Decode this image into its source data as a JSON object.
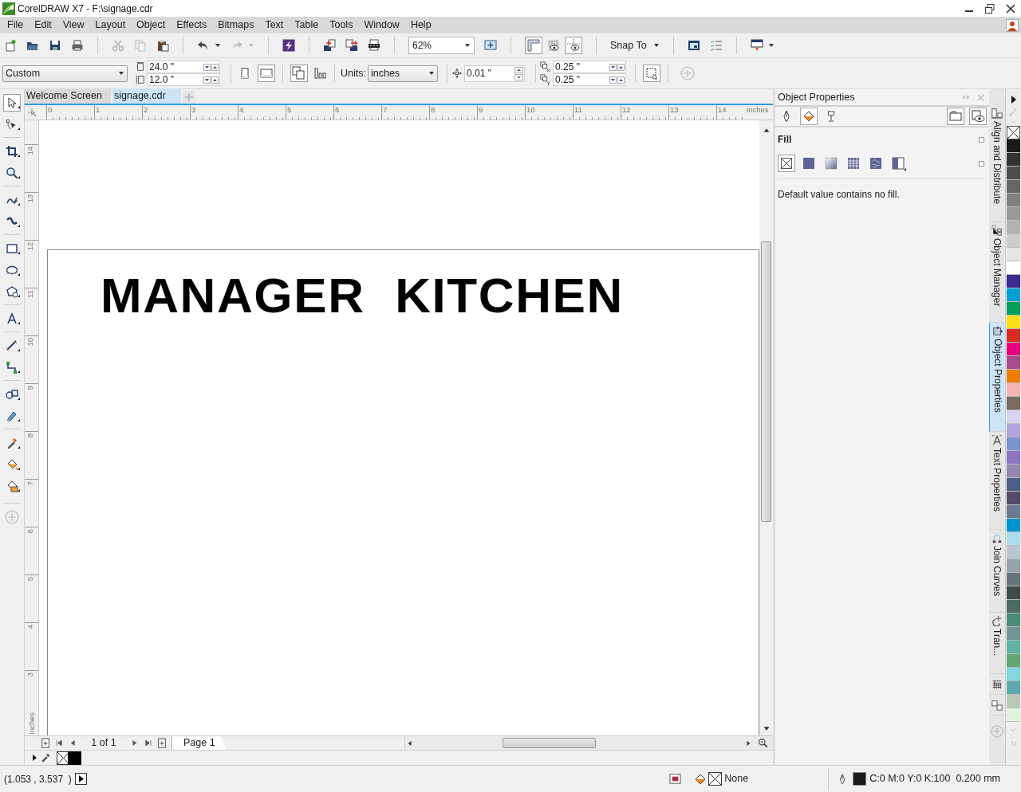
{
  "window": {
    "title": "CorelDRAW X7 - F:\\signage.cdr"
  },
  "menu": [
    "File",
    "Edit",
    "View",
    "Layout",
    "Object",
    "Effects",
    "Bitmaps",
    "Text",
    "Table",
    "Tools",
    "Window",
    "Help"
  ],
  "toolbar": {
    "zoom": "62%",
    "snap_to": "Snap To"
  },
  "property_bar": {
    "preset": "Custom",
    "width": "24.0 \"",
    "height": "12.0 \"",
    "units_label": "Units:",
    "units": "inches",
    "nudge": "0.01 \"",
    "duplicate_x": "0.25 \"",
    "duplicate_y": "0.25 \""
  },
  "toolbox": [
    {
      "kind": "pick",
      "selected": true
    },
    {
      "kind": "shape",
      "selected": false
    },
    {
      "kind": "crop",
      "selected": false
    },
    {
      "kind": "zoom",
      "selected": false
    },
    {
      "kind": "freehand",
      "selected": false
    },
    {
      "kind": "artistic",
      "selected": false
    },
    {
      "kind": "rectangle",
      "selected": false
    },
    {
      "kind": "ellipse",
      "selected": false
    },
    {
      "kind": "polygon",
      "selected": false
    },
    {
      "kind": "text",
      "selected": false
    },
    {
      "kind": "dimension",
      "selected": false
    },
    {
      "kind": "connector",
      "selected": false
    },
    {
      "kind": "blend",
      "selected": false
    },
    {
      "kind": "transparency",
      "selected": false
    },
    {
      "kind": "eyedropper",
      "selected": false
    },
    {
      "kind": "fill",
      "selected": false
    },
    {
      "kind": "smartfill",
      "selected": false
    }
  ],
  "document_tabs": [
    {
      "label": "Welcome Screen",
      "selected": false
    },
    {
      "label": "signage.cdr",
      "selected": true
    }
  ],
  "horizontal_ruler": {
    "labels": [
      "0",
      "1",
      "2",
      "3",
      "4",
      "5",
      "6",
      "7",
      "8",
      "9",
      "10",
      "11",
      "12",
      "13",
      "14"
    ],
    "unit": "inches"
  },
  "vertical_ruler": {
    "labels": [
      "14",
      "13",
      "12",
      "11",
      "10",
      "9",
      "8",
      "7",
      "6",
      "5",
      "4",
      "3"
    ],
    "unit": "inches"
  },
  "canvas": {
    "text": "MANAGER  KITCHEN"
  },
  "page_navigator": {
    "position": "1 of 1",
    "pages": [
      {
        "label": "Page 1",
        "selected": true
      }
    ]
  },
  "document_palette": [
    {
      "kind": "none"
    },
    {
      "kind": "color",
      "color": "#000000"
    }
  ],
  "docker": {
    "title": "Object Properties",
    "tabs": [
      {
        "kind": "outline",
        "selected": false
      },
      {
        "kind": "fill",
        "selected": true
      },
      {
        "kind": "transparency",
        "selected": false
      }
    ],
    "section": "Fill",
    "fill_types": [
      {
        "kind": "none",
        "selected": true
      },
      {
        "kind": "uniform",
        "selected": false
      },
      {
        "kind": "fountain",
        "selected": false
      },
      {
        "kind": "vector",
        "selected": false
      },
      {
        "kind": "bitmap",
        "selected": false
      },
      {
        "kind": "twocolor",
        "selected": false
      }
    ],
    "message": "Default value contains no fill."
  },
  "docker_tabs": [
    {
      "kind": "align",
      "label": "Align and Distribute",
      "selected": false
    },
    {
      "kind": "manager",
      "label": "Object Manager",
      "selected": false
    },
    {
      "kind": "properties",
      "label": "Object Properties",
      "selected": true
    },
    {
      "kind": "text",
      "label": "Text Properties",
      "selected": false
    },
    {
      "kind": "join",
      "label": "Join Curves",
      "selected": false
    },
    {
      "kind": "transform",
      "label": "Tran...",
      "selected": false
    }
  ],
  "color_palette": [
    {
      "kind": "none"
    },
    {
      "kind": "color",
      "color": "#1a1a1a"
    },
    {
      "kind": "color",
      "color": "#333333"
    },
    {
      "kind": "color",
      "color": "#4d4d4d"
    },
    {
      "kind": "color",
      "color": "#666666"
    },
    {
      "kind": "color",
      "color": "#808080"
    },
    {
      "kind": "color",
      "color": "#999999"
    },
    {
      "kind": "color",
      "color": "#b3b3b3"
    },
    {
      "kind": "color",
      "color": "#cccccc"
    },
    {
      "kind": "color",
      "color": "#e6e6e6"
    },
    {
      "kind": "color",
      "color": "#ffffff"
    },
    {
      "kind": "color",
      "color": "#3a2d91"
    },
    {
      "kind": "color",
      "color": "#00a0d6"
    },
    {
      "kind": "color",
      "color": "#00a05a"
    },
    {
      "kind": "color",
      "color": "#f7e01a"
    },
    {
      "kind": "color",
      "color": "#dc2b20"
    },
    {
      "kind": "color",
      "color": "#e5007f"
    },
    {
      "kind": "color",
      "color": "#a94a8f"
    },
    {
      "kind": "color",
      "color": "#ef7d00"
    },
    {
      "kind": "color",
      "color": "#f8b3b5"
    },
    {
      "kind": "color",
      "color": "#7a6a60"
    },
    {
      "kind": "color",
      "color": "#d8d3ef"
    },
    {
      "kind": "color",
      "color": "#b1a4dd"
    },
    {
      "kind": "color",
      "color": "#7b93cf"
    },
    {
      "kind": "color",
      "color": "#8e74c4"
    },
    {
      "kind": "color",
      "color": "#9488b3"
    },
    {
      "kind": "color",
      "color": "#4e5d86"
    },
    {
      "kind": "color",
      "color": "#544c69"
    },
    {
      "kind": "color",
      "color": "#6b7c92"
    },
    {
      "kind": "color",
      "color": "#0095cf"
    },
    {
      "kind": "color",
      "color": "#aedcef"
    },
    {
      "kind": "color",
      "color": "#b8c8d3"
    },
    {
      "kind": "color",
      "color": "#95a4ab"
    },
    {
      "kind": "color",
      "color": "#67757c"
    },
    {
      "kind": "color",
      "color": "#3f4a4c"
    },
    {
      "kind": "color",
      "color": "#4d6a66"
    },
    {
      "kind": "color",
      "color": "#4a8a78"
    },
    {
      "kind": "color",
      "color": "#739595"
    },
    {
      "kind": "color",
      "color": "#5fb3a0"
    },
    {
      "kind": "color",
      "color": "#63a874"
    },
    {
      "kind": "color",
      "color": "#81d8de"
    },
    {
      "kind": "color",
      "color": "#5eaaae"
    },
    {
      "kind": "color",
      "color": "#b8c9b8"
    },
    {
      "kind": "color",
      "color": "#dff5dc"
    }
  ],
  "status_bar": {
    "coordinates": "(1.053 , 3.537  )",
    "fill": "None",
    "outline": "C:0 M:0 Y:0 K:100  0.200 mm"
  }
}
